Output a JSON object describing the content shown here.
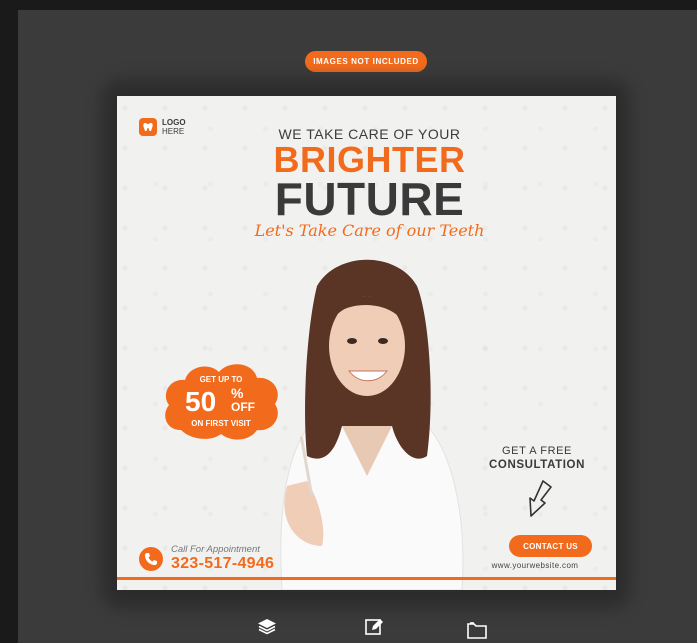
{
  "banner": {
    "label": "IMAGES NOT INCLUDED"
  },
  "logo": {
    "line1": "LOGO",
    "line2": "HERE"
  },
  "headline": {
    "small": "WE TAKE CARE OF YOUR",
    "brighter": "BRIGHTER",
    "future": "FUTURE",
    "script": "Let's Take Care of our Teeth"
  },
  "offer": {
    "get_up_to": "GET UP TO",
    "percent": "50",
    "percent_sign": "%",
    "off": "OFF",
    "on_first_visit": "ON FIRST VISIT"
  },
  "consultation": {
    "line1": "GET A FREE",
    "line2": "CONSULTATION"
  },
  "cta": {
    "label": "CONTACT US"
  },
  "website": "www.yourwebsite.com",
  "call": {
    "label": "Call For Appointment",
    "number": "323-517-4946"
  },
  "colors": {
    "accent": "#f26b1d",
    "dark_text": "#3a3a3a",
    "poster_bg": "#f1f1f0",
    "canvas": "#3b3b3b"
  },
  "icons": [
    "tooth-icon",
    "phone-icon",
    "arrow-down-icon",
    "layers-icon",
    "edit-icon",
    "folder-icon"
  ]
}
